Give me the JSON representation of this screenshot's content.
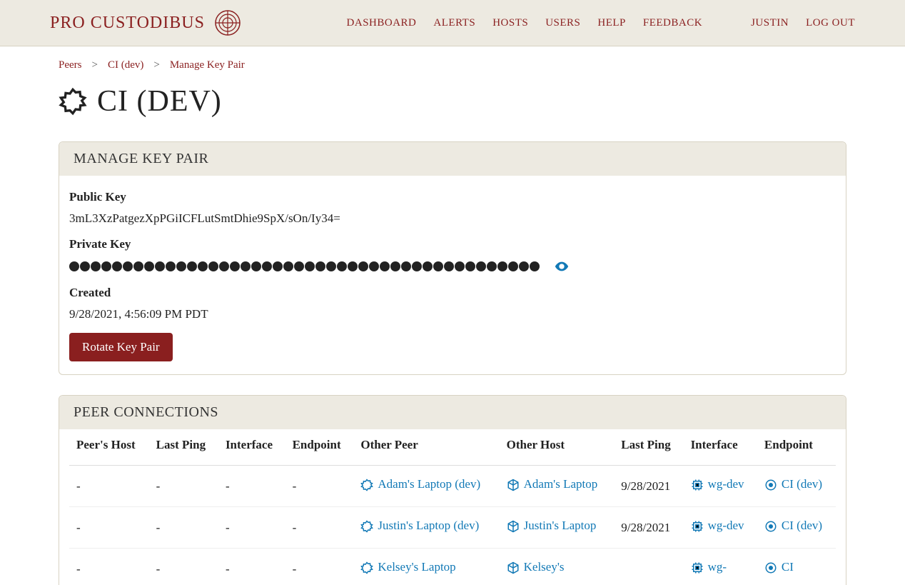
{
  "brand": "PRO CUSTODIBUS",
  "nav": {
    "dashboard": "DASHBOARD",
    "alerts": "ALERTS",
    "hosts": "HOSTS",
    "users": "USERS",
    "help": "HELP",
    "feedback": "FEEDBACK",
    "user": "JUSTIN",
    "logout": "LOG OUT"
  },
  "breadcrumb": {
    "peers": "Peers",
    "ci": "CI (dev)",
    "current": "Manage Key Pair",
    "sep": ">"
  },
  "page_title": "CI (DEV)",
  "keypair": {
    "panel_title": "MANAGE KEY PAIR",
    "public_label": "Public Key",
    "public_value": "3mL3XzPatgezXpPGiICFLutSmtDhie9SpX/sOn/Iy34=",
    "private_label": "Private Key",
    "private_dot_count": 44,
    "created_label": "Created",
    "created_value": "9/28/2021, 4:56:09 PM PDT",
    "rotate_button": "Rotate Key Pair"
  },
  "connections": {
    "panel_title": "PEER CONNECTIONS",
    "headers": {
      "peers_host": "Peer's Host",
      "last_ping_a": "Last Ping",
      "interface_a": "Interface",
      "endpoint_a": "Endpoint",
      "other_peer": "Other Peer",
      "other_host": "Other Host",
      "last_ping_b": "Last Ping",
      "interface_b": "Interface",
      "endpoint_b": "Endpoint"
    },
    "rows": [
      {
        "peers_host": "-",
        "last_ping_a": "-",
        "interface_a": "-",
        "endpoint_a": "-",
        "other_peer": "Adam's Laptop (dev)",
        "other_host": "Adam's Laptop",
        "last_ping_b": "9/28/2021",
        "interface_b": "wg-dev",
        "endpoint_b": "CI (dev)"
      },
      {
        "peers_host": "-",
        "last_ping_a": "-",
        "interface_a": "-",
        "endpoint_a": "-",
        "other_peer": "Justin's Laptop (dev)",
        "other_host": "Justin's Laptop",
        "last_ping_b": "9/28/2021",
        "interface_b": "wg-dev",
        "endpoint_b": "CI (dev)"
      },
      {
        "peers_host": "-",
        "last_ping_a": "-",
        "interface_a": "-",
        "endpoint_a": "-",
        "other_peer": "Kelsey's Laptop",
        "other_host": "Kelsey's",
        "last_ping_b": "",
        "interface_b": "wg-",
        "endpoint_b": "CI"
      }
    ]
  }
}
